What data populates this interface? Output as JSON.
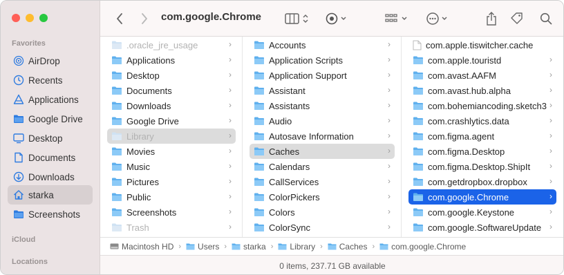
{
  "window": {
    "title": "com.google.Chrome"
  },
  "sidebar": {
    "favorites_label": "Favorites",
    "items": [
      {
        "label": "AirDrop",
        "icon": "airdrop-icon"
      },
      {
        "label": "Recents",
        "icon": "clock-icon"
      },
      {
        "label": "Applications",
        "icon": "applications-icon"
      },
      {
        "label": "Google Drive",
        "icon": "folder-icon"
      },
      {
        "label": "Desktop",
        "icon": "desktop-icon"
      },
      {
        "label": "Documents",
        "icon": "document-icon"
      },
      {
        "label": "Downloads",
        "icon": "download-icon"
      },
      {
        "label": "starka",
        "icon": "home-icon",
        "selected": true
      },
      {
        "label": "Screenshots",
        "icon": "folder-icon"
      }
    ],
    "icloud_label": "iCloud",
    "locations_label": "Locations"
  },
  "toolbar": {
    "back": "chevron-left-icon",
    "forward": "chevron-right-icon",
    "view": "columns-view-icon",
    "share_icon": "share-icon",
    "tag_icon": "tag-icon",
    "search_icon": "search-icon"
  },
  "columns": {
    "col1": [
      {
        "label": ".oracle_jre_usage",
        "dim": true
      },
      {
        "label": "Applications"
      },
      {
        "label": "Desktop"
      },
      {
        "label": "Documents"
      },
      {
        "label": "Downloads"
      },
      {
        "label": "Google Drive"
      },
      {
        "label": "Library",
        "dim": true,
        "selected": true
      },
      {
        "label": "Movies"
      },
      {
        "label": "Music"
      },
      {
        "label": "Pictures"
      },
      {
        "label": "Public"
      },
      {
        "label": "Screenshots"
      },
      {
        "label": "Trash",
        "dim": true
      }
    ],
    "col2": [
      {
        "label": "Accounts"
      },
      {
        "label": "Application Scripts"
      },
      {
        "label": "Application Support"
      },
      {
        "label": "Assistant"
      },
      {
        "label": "Assistants"
      },
      {
        "label": "Audio"
      },
      {
        "label": "Autosave Information"
      },
      {
        "label": "Caches",
        "selected": true
      },
      {
        "label": "Calendars"
      },
      {
        "label": "CallServices"
      },
      {
        "label": "ColorPickers"
      },
      {
        "label": "Colors"
      },
      {
        "label": "ColorSync"
      }
    ],
    "col3": [
      {
        "label": "com.apple.tiswitcher.cache",
        "doc": true
      },
      {
        "label": "com.apple.touristd"
      },
      {
        "label": "com.avast.AAFM"
      },
      {
        "label": "com.avast.hub.alpha"
      },
      {
        "label": "com.bohemiancoding.sketch3"
      },
      {
        "label": "com.crashlytics.data"
      },
      {
        "label": "com.figma.agent"
      },
      {
        "label": "com.figma.Desktop"
      },
      {
        "label": "com.figma.Desktop.ShipIt"
      },
      {
        "label": "com.getdropbox.dropbox"
      },
      {
        "label": "com.google.Chrome",
        "active": true
      },
      {
        "label": "com.google.Keystone"
      },
      {
        "label": "com.google.SoftwareUpdate"
      }
    ]
  },
  "pathbar": [
    "Macintosh HD",
    "Users",
    "starka",
    "Library",
    "Caches",
    "com.google.Chrome"
  ],
  "status": "0 items, 237.71 GB available"
}
